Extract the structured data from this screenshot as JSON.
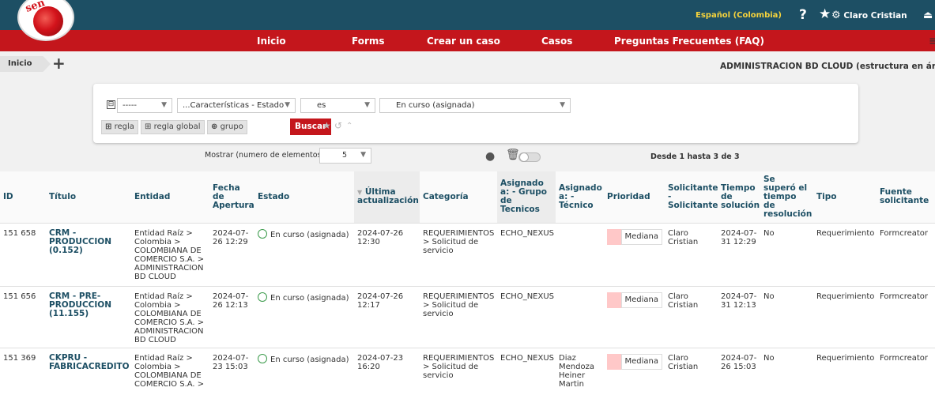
{
  "header": {
    "logo_text": "sen",
    "language": "Español (Colombia)",
    "help_icon": "question-icon",
    "fav_icon": "star-icon",
    "user_icon": "gear-icon",
    "user_name": "Claro Cristian",
    "logout_icon": "logout-icon"
  },
  "nav": {
    "items": [
      "Inicio",
      "Forms",
      "Crear un caso",
      "Casos",
      "Preguntas Frecuentes (FAQ)"
    ],
    "menu_icon": "≡"
  },
  "breadcrumb": {
    "home": "Inicio",
    "add": "+",
    "page_title": "ADMINISTRACION BD CLOUD (estructura en árbo"
  },
  "search": {
    "toggle": "⊟",
    "link_select": "-----",
    "field_select": "...Características - Estado",
    "operator_select": "es",
    "value_select": "En curso (asignada)",
    "rule_btn": "regla",
    "global_rule_btn": "regla global",
    "group_btn": "grupo",
    "search_btn": "Buscar"
  },
  "list_controls": {
    "show_label": "Mostrar (numero de elementos)",
    "show_value": "5",
    "range_text": "Desde 1 hasta 3 de 3"
  },
  "table": {
    "columns": [
      "ID",
      "Título",
      "Entidad",
      "Fecha de Apertura",
      "Estado",
      "Última actualización",
      "Categoría",
      "Asignado a: - Grupo de Tecnicos",
      "Asignado a: - Técnico",
      "Prioridad",
      "Solicitante - Solicitante",
      "Tiempo de solución",
      "Se superó el tiempo de resolución",
      "Tipo",
      "Fuente solicitante"
    ],
    "sort_marker": "▼",
    "rows": [
      {
        "id": "151 658",
        "title": "CRM - PRODUCCION (0.152)",
        "entity": "Entidad Raíz > Colombia > COLOMBIANA DE COMERCIO S.A. > ADMINISTRACION BD CLOUD",
        "opened": "2024-07-26 12:29",
        "status": "En curso (asignada)",
        "updated": "2024-07-26 12:30",
        "category": "REQUERIMIENTOS > Solicitud de servicio",
        "group": "ECHO_NEXUS",
        "tech": "",
        "priority": "Mediana",
        "requester": "Claro Cristian",
        "solution_time": "2024-07-31 12:29",
        "exceeded": "No",
        "type": "Requerimiento",
        "source": "Formcreator"
      },
      {
        "id": "151 656",
        "title": "CRM - PRE-PRODUCCION (11.155)",
        "entity": "Entidad Raíz > Colombia > COLOMBIANA DE COMERCIO S.A. > ADMINISTRACION BD CLOUD",
        "opened": "2024-07-26 12:13",
        "status": "En curso (asignada)",
        "updated": "2024-07-26 12:17",
        "category": "REQUERIMIENTOS > Solicitud de servicio",
        "group": "ECHO_NEXUS",
        "tech": "",
        "priority": "Mediana",
        "requester": "Claro Cristian",
        "solution_time": "2024-07-31 12:13",
        "exceeded": "No",
        "type": "Requerimiento",
        "source": "Formcreator"
      },
      {
        "id": "151 369",
        "title": "CKPRU - FABRICACREDITO",
        "entity": "Entidad Raíz > Colombia > COLOMBIANA DE COMERCIO S.A. >",
        "opened": "2024-07-23 15:03",
        "status": "En curso (asignada)",
        "updated": "2024-07-23 16:20",
        "category": "REQUERIMIENTOS > Solicitud de servicio",
        "group": "ECHO_NEXUS",
        "tech": "Diaz Mendoza Heiner Martin",
        "priority": "Mediana",
        "requester": "Claro Cristian",
        "solution_time": "2024-07-26 15:03",
        "exceeded": "No",
        "type": "Requerimiento",
        "source": "Formcreator"
      }
    ]
  },
  "colors": {
    "header_blue": "#1d4f64",
    "nav_red": "#c4161c",
    "language_yellow": "#f6d33c",
    "priority_pink": "#ffc8c8",
    "status_green": "#3c9b4c"
  }
}
